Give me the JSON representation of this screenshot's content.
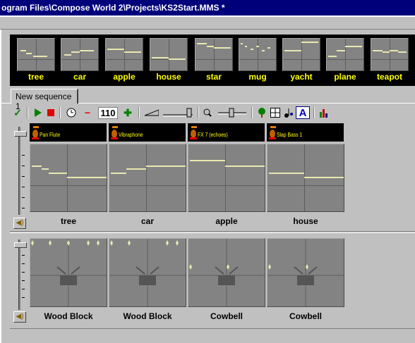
{
  "window": {
    "title": "ogram Files\\Compose World 2\\Projects\\KS2Start.MMS *"
  },
  "palette": {
    "motifs": [
      {
        "label": "tree"
      },
      {
        "label": "car"
      },
      {
        "label": "apple"
      },
      {
        "label": "house"
      },
      {
        "label": "star"
      },
      {
        "label": "mug"
      },
      {
        "label": "yacht"
      },
      {
        "label": "plane"
      },
      {
        "label": "teapot"
      }
    ]
  },
  "tabs": [
    {
      "label": "New sequence 1"
    }
  ],
  "toolbar": {
    "tempo": "110"
  },
  "melody": {
    "tracks": [
      {
        "instrument": "Pan Flute",
        "motif": "tree"
      },
      {
        "instrument": "Vibraphone",
        "motif": "car"
      },
      {
        "instrument": "FX 7 (echoes)",
        "motif": "apple"
      },
      {
        "instrument": "Slap Bass 1",
        "motif": "house"
      }
    ]
  },
  "percussion": {
    "tracks": [
      {
        "label": "Wood Block"
      },
      {
        "label": "Wood Block"
      },
      {
        "label": "Cowbell"
      },
      {
        "label": "Cowbell"
      }
    ]
  },
  "colors": {
    "title_bg": "#00007b",
    "palette_bg": "#000000",
    "motif_label": "#ffff00",
    "note": "#e8e8b0",
    "grid": "#838383"
  }
}
